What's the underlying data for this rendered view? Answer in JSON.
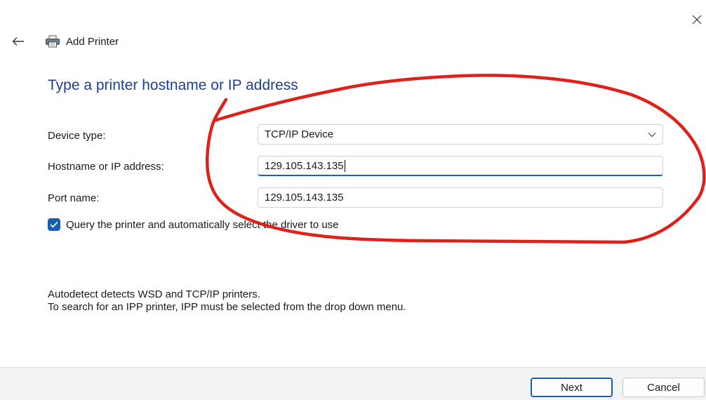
{
  "window": {
    "title": "Add Printer",
    "close_icon": "close-icon",
    "back_icon": "back-arrow-icon",
    "printer_icon": "printer-icon"
  },
  "page": {
    "heading": "Type a printer hostname or IP address"
  },
  "form": {
    "device_type": {
      "label": "Device type:",
      "value": "TCP/IP Device",
      "icon": "chevron-down-icon"
    },
    "hostname": {
      "label": "Hostname or IP address:",
      "value": "129.105.143.135"
    },
    "port_name": {
      "label": "Port name:",
      "value": "129.105.143.135"
    },
    "query_printer": {
      "label": "Query the printer and automatically select the driver to use",
      "checked": true
    }
  },
  "info": {
    "line1": "Autodetect detects WSD and TCP/IP printers.",
    "line2": "To search for an IPP printer, IPP must be selected from the drop down menu."
  },
  "footer": {
    "next_label": "Next",
    "cancel_label": "Cancel"
  },
  "colors": {
    "accent": "#1a5fb4",
    "heading": "#1c3f95",
    "annotation": "#e0201b",
    "footer_bg": "#f3f3f3"
  }
}
